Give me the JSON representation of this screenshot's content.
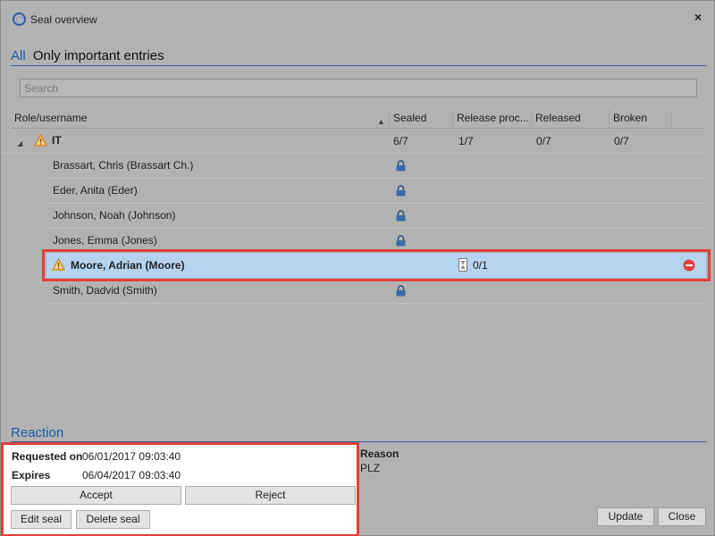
{
  "window": {
    "title": "Seal overview",
    "close_glyph": "×"
  },
  "filter": {
    "all_label": "All",
    "important_label": "Only important entries"
  },
  "search": {
    "placeholder": "Search"
  },
  "columns": {
    "role": "Role/username",
    "sealed": "Sealed",
    "release": "Release proc...",
    "released": "Released",
    "broken": "Broken"
  },
  "group": {
    "name": "IT",
    "sealed": "6/7",
    "release": "1/7",
    "released": "0/7",
    "broken": "0/7",
    "icon": "warning-icon"
  },
  "users": [
    {
      "name": "Brassart, Chris (Brassart Ch.)",
      "icon": "lock-icon"
    },
    {
      "name": "Eder, Anita (Eder)",
      "icon": "lock-icon"
    },
    {
      "name": "Johnson, Noah (Johnson)",
      "icon": "lock-icon"
    },
    {
      "name": "Jones, Emma (Jones)",
      "icon": "lock-icon"
    },
    {
      "name": "Moore, Adrian (Moore)",
      "release": "0/1",
      "icon": "hourglass-icon",
      "selected": true
    },
    {
      "name": "Smith, Dadvid (Smith)",
      "icon": "lock-icon"
    }
  ],
  "reaction": {
    "title": "Reaction",
    "requested_label": "Requested on",
    "requested_value": "06/01/2017 09:03:40",
    "expires_label": "Expires",
    "expires_value": "06/04/2017 09:03:40",
    "accept_label": "Accept",
    "reject_label": "Reject",
    "edit_label": "Edit seal",
    "delete_label": "Delete seal",
    "reason_label": "Reason",
    "reason_value": "PLZ"
  },
  "footer": {
    "update_label": "Update",
    "close_label": "Close"
  },
  "colors": {
    "accent": "#1e5aa8",
    "highlight": "#e0403e",
    "selected": "#b4d3ee",
    "remove": "#e0403e"
  }
}
